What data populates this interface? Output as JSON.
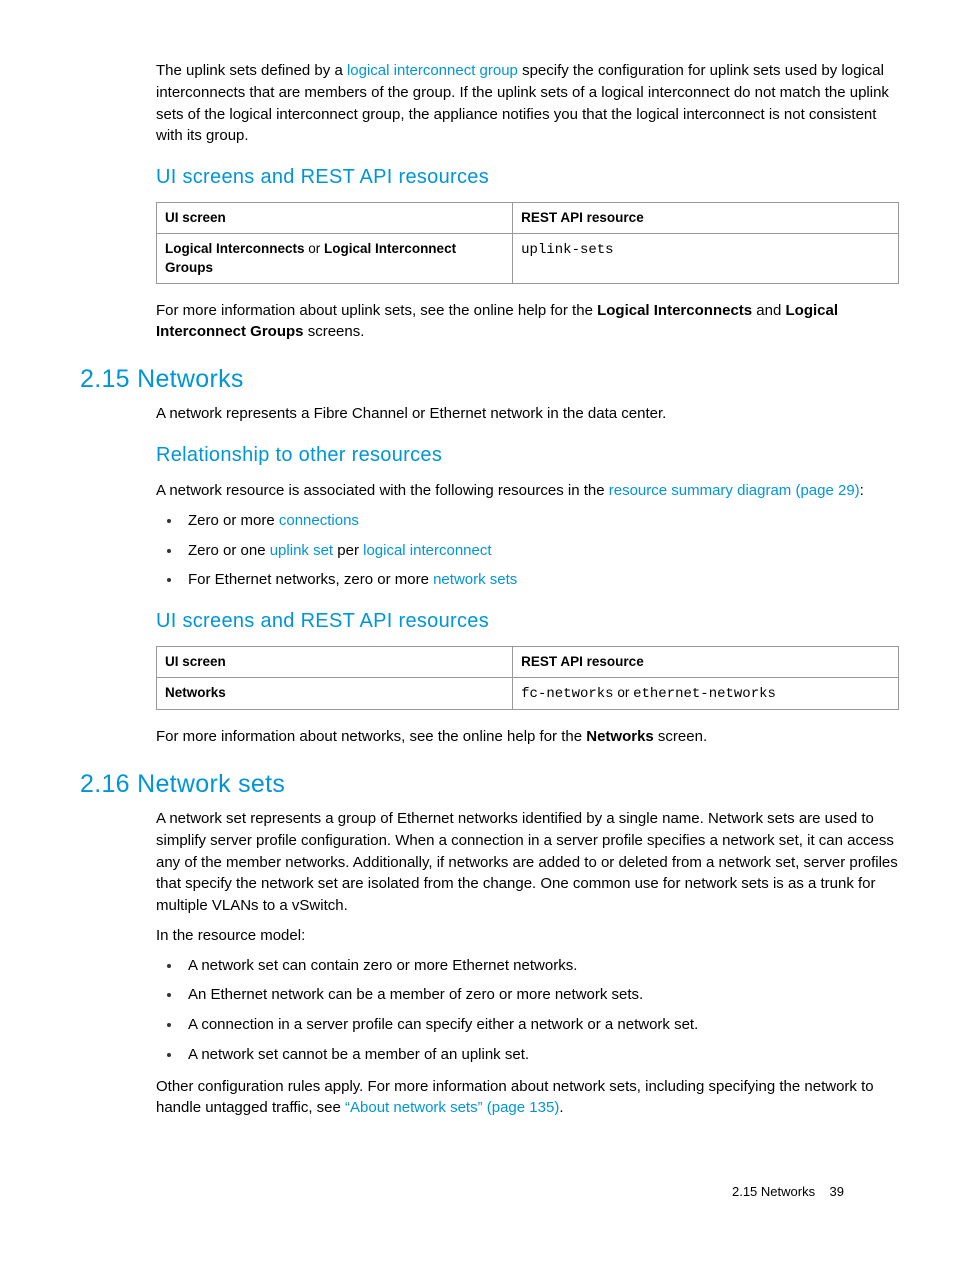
{
  "intro_para_parts": {
    "pre": "The uplink sets defined by a ",
    "link": "logical interconnect group",
    "post": " specify the configuration for uplink sets used by logical interconnects that are members of the group. If the uplink sets of a logical interconnect do not match the uplink sets of the logical interconnect group, the appliance notifies you that the logical interconnect is not consistent with its group."
  },
  "ui_rest_heading": "UI screens and REST API resources",
  "table1": {
    "h1": "UI screen",
    "h2": "REST API resource",
    "cell_ui_b1": "Logical Interconnects",
    "cell_ui_mid": " or ",
    "cell_ui_b2": "Logical Interconnect Groups",
    "cell_api": "uplink-sets"
  },
  "more_info_1": {
    "pre": "For more information about uplink sets, see the online help for the ",
    "b1": "Logical Interconnects",
    "mid": " and ",
    "b2": "Logical Interconnect Groups",
    "post": " screens."
  },
  "sec215": {
    "heading": "2.15 Networks",
    "p1": "A network represents a Fibre Channel or Ethernet network in the data center.",
    "rel_heading": "Relationship to other resources",
    "rel_p_pre": "A network resource is associated with the following resources in the ",
    "rel_p_link": "resource summary diagram (page 29)",
    "rel_p_post": ":",
    "li1_pre": "Zero or more ",
    "li1_link": "connections",
    "li2_pre": "Zero or one ",
    "li2_link1": "uplink set",
    "li2_mid": " per ",
    "li2_link2": "logical interconnect",
    "li3_pre": "For Ethernet networks, zero or more ",
    "li3_link": "network sets"
  },
  "table2": {
    "h1": "UI screen",
    "h2": "REST API resource",
    "cell_ui_b": "Networks",
    "cell_api_c1": "fc-networks",
    "cell_api_mid": " or ",
    "cell_api_c2": "ethernet-networks"
  },
  "more_info_2": {
    "pre": "For more information about networks, see the online help for the ",
    "b": "Networks",
    "post": " screen."
  },
  "sec216": {
    "heading": "2.16 Network sets",
    "p1": "A network set represents a group of Ethernet networks identified by a single name. Network sets are used to simplify server profile configuration. When a connection in a server profile specifies a network set, it can access any of the member networks. Additionally, if networks are added to or deleted from a network set, server profiles that specify the network set are isolated from the change. One common use for network sets is as a trunk for multiple VLANs to a vSwitch.",
    "p2": "In the resource model:",
    "li1": "A network set can contain zero or more Ethernet networks.",
    "li2": "An Ethernet network can be a member of zero or more network sets.",
    "li3": "A connection in a server profile can specify either a network or a network set.",
    "li4": "A network set cannot be a member of an uplink set.",
    "p3_pre": "Other configuration rules apply. For more information about network sets, including specifying the network to handle untagged traffic, see ",
    "p3_link": "“About network sets” (page 135)",
    "p3_post": "."
  },
  "footer": {
    "section": "2.15 Networks",
    "page": "39"
  }
}
